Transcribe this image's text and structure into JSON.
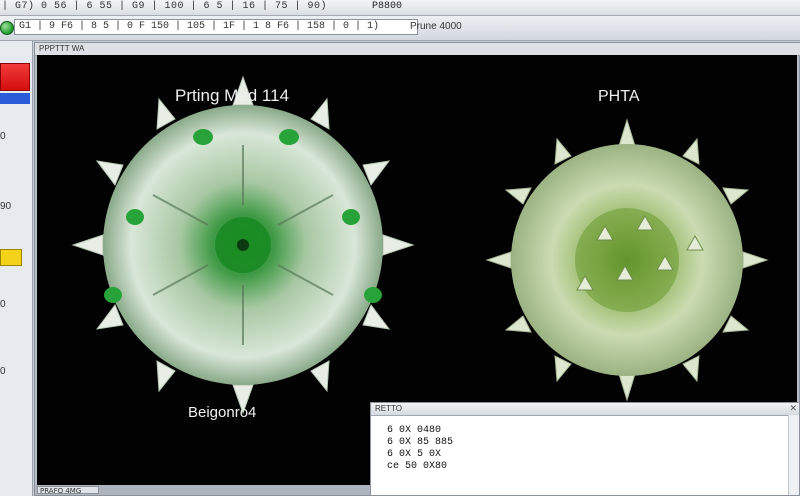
{
  "titlebar": {
    "left_text": "| G7) 0 56 | 6 55 | G9 | 100 | 6 5 | 16 | 75 | 90)",
    "center_text": "P8800"
  },
  "toolbar": {
    "path_text": "G1 | 9 F6 | 8 5 | 0 F 150 | 105 | 1F | 1 8 F6 | 158 | 0 | 1)",
    "label": "Prune 4000"
  },
  "sidebar": {
    "text1": "0",
    "text2": "90",
    "text3": "0",
    "text4": "0"
  },
  "viewer": {
    "header": "PPPTTT WA",
    "bottom_tab": "PRAFO 4MG"
  },
  "specimens": [
    {
      "top_label": "Prting Med 114",
      "bottom_label": "Beigonro4"
    },
    {
      "top_label": "PHTA"
    }
  ],
  "info_panel": {
    "header": "RETTO",
    "lines": [
      "6 0X 0480",
      "6 0X 85 885",
      "6 0X 5 0X",
      "ce 50 0X80"
    ]
  },
  "colors": {
    "swatch_red": "#e41f1f",
    "swatch_yellow": "#f5d21a",
    "swatch_blue": "#2a5bd6"
  }
}
